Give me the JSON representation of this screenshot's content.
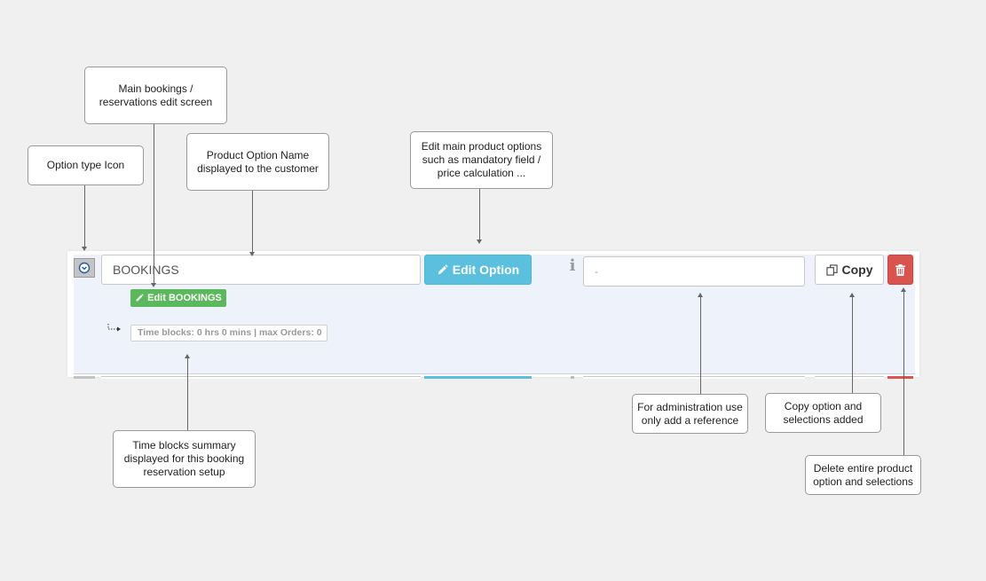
{
  "callouts": {
    "main_bookings": "Main bookings / reservations edit screen",
    "option_type_icon": "Option type Icon",
    "product_option_name": "Product Option Name displayed to the customer",
    "edit_main_options": "Edit main product options such as mandatory field / price calculation ...",
    "time_blocks_summary": "Time blocks summary displayed for this booking reservation setup",
    "admin_reference": "For administration use only add a reference",
    "copy_option": "Copy option and selections added",
    "delete_option": "Delete entire product option and selections"
  },
  "option_row": {
    "type_icon": "clock-icon",
    "name_value": "BOOKINGS",
    "edit_option_label": "Edit Option",
    "info_icon_glyph": "i",
    "reference_value": "-",
    "copy_label": "Copy",
    "edit_bookings_label": "Edit BOOKINGS",
    "time_blocks_text": "Time blocks: 0 hrs 0 mins | max Orders: 0"
  },
  "colors": {
    "edit_option": "#5bc0de",
    "edit_bookings": "#5cb85c",
    "delete": "#d9534f",
    "panel_bg": "#eef3fb"
  }
}
